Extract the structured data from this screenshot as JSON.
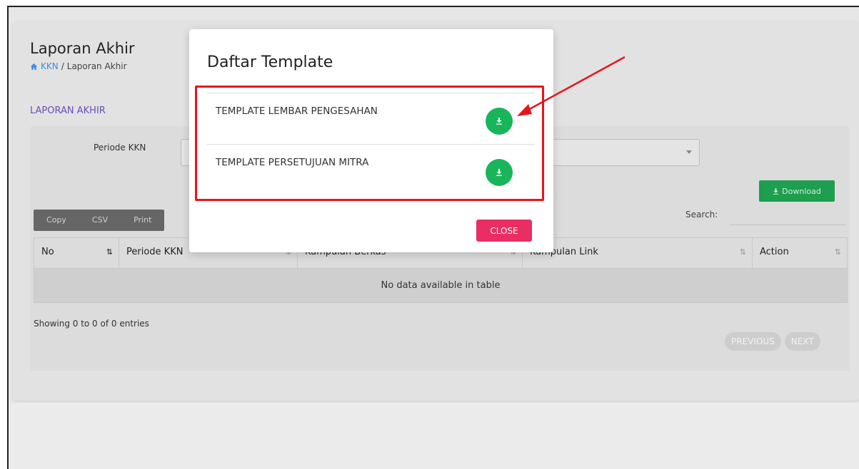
{
  "page": {
    "title": "Laporan Akhir",
    "breadcrumb_link": "KKN",
    "breadcrumb_separator": "/",
    "breadcrumb_current": "Laporan Akhir",
    "section_title": "LAPORAN AKHIR"
  },
  "filter": {
    "periode_label": "Periode KKN"
  },
  "toolbar": {
    "download_label": "Download",
    "copy_label": "Copy",
    "csv_label": "CSV",
    "print_label": "Print",
    "search_label": "Search:"
  },
  "table": {
    "columns": [
      "No",
      "Periode KKN",
      "Kumpulan Berkas",
      "Kumpulan Link",
      "Action"
    ],
    "sort_glyph": "⇅",
    "empty_text": "No data available in table",
    "showing_text": "Showing 0 to 0 of 0 entries",
    "previous_label": "PREVIOUS",
    "next_label": "NEXT"
  },
  "modal": {
    "title": "Daftar Template",
    "items": [
      {
        "label": "TEMPLATE LEMBAR PENGESAHAN"
      },
      {
        "label": "TEMPLATE PERSETUJUAN MITRA"
      }
    ],
    "close_label": "CLOSE"
  },
  "icons": {
    "home": "home-icon",
    "download": "download-icon",
    "dropdown": "chevron-down-icon"
  },
  "colors": {
    "accent_green": "#19b55b",
    "close_pink": "#ea2d63",
    "highlight_red": "#e8141b",
    "section_purple": "#6a4fb8",
    "link_blue": "#3a8ee6"
  }
}
